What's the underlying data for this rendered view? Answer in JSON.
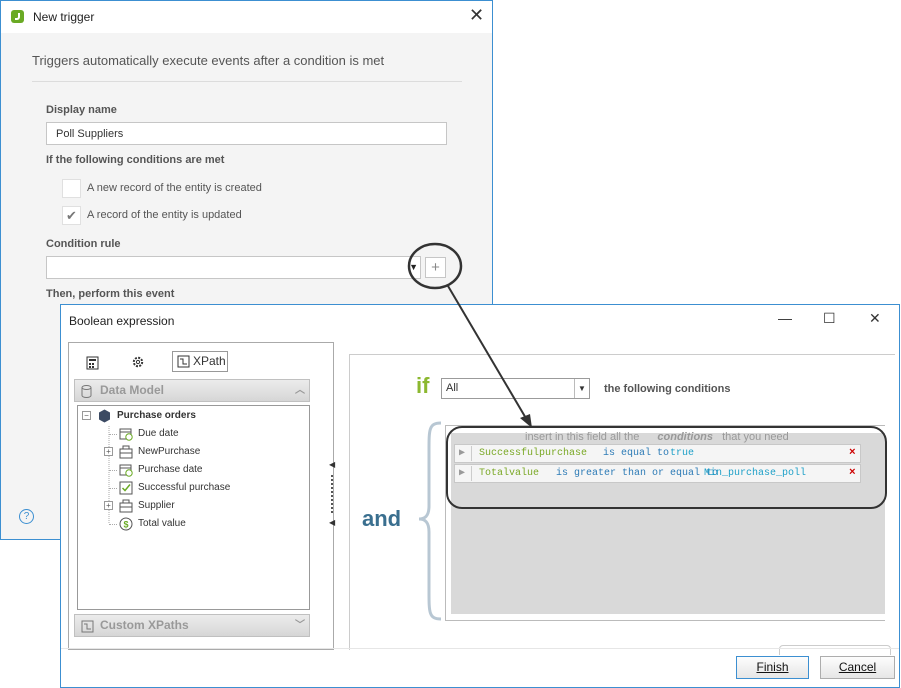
{
  "trigger_window": {
    "title": "New trigger",
    "close_glyph": "✕",
    "subtitle": "Triggers automatically execute events after a condition is met",
    "display_name_label": "Display name",
    "display_name_value": "Poll Suppliers",
    "conditions_label": "If the following conditions are met",
    "checkbox_created": {
      "label": "A new record of the entity is created",
      "checked": false
    },
    "checkbox_updated": {
      "label": "A record of the entity is updated",
      "checked": true
    },
    "condition_rule_label": "Condition rule",
    "condition_rule_value": "",
    "add_glyph": "+",
    "event_label": "Then, perform this event",
    "help_glyph": "?"
  },
  "boolean_dialog": {
    "title": "Boolean expression",
    "minimize_glyph": "—",
    "maximize_glyph": "☐",
    "close_glyph": "✕",
    "toolbar": {
      "xpath_tab_label": "XPath"
    },
    "data_model_header": "Data Model",
    "custom_xpaths_header": "Custom XPaths",
    "tree": {
      "root": "Purchase orders",
      "children": [
        {
          "label": "Due date",
          "icon": "date-icon",
          "expandable": false
        },
        {
          "label": "NewPurchase",
          "icon": "entity-icon",
          "expandable": true
        },
        {
          "label": "Purchase date",
          "icon": "date-icon",
          "expandable": false
        },
        {
          "label": "Successful purchase",
          "icon": "boolean-icon",
          "expandable": false
        },
        {
          "label": "Supplier",
          "icon": "entity-icon",
          "expandable": true
        },
        {
          "label": "Total value",
          "icon": "currency-icon",
          "expandable": false
        }
      ]
    },
    "if_word": "if",
    "quantifier_value": "All",
    "following_conditions": "the following conditions",
    "and_word": "and",
    "hint_prefix": "insert in this field all the",
    "hint_keyword": "conditions",
    "hint_suffix": "that you need",
    "conditions": [
      {
        "field": "Successfulpurchase",
        "operator": "is equal to",
        "value": "true"
      },
      {
        "field": "Totalvalue",
        "operator": "is greater than or equal to",
        "value": "Min_purchase_poll"
      }
    ],
    "finish_label": "Finish",
    "cancel_label": "Cancel"
  },
  "colors": {
    "accent": "#3c8fd1",
    "if_green": "#8cb830",
    "and_blue": "#3a6f8f",
    "annotation": "#333333"
  }
}
